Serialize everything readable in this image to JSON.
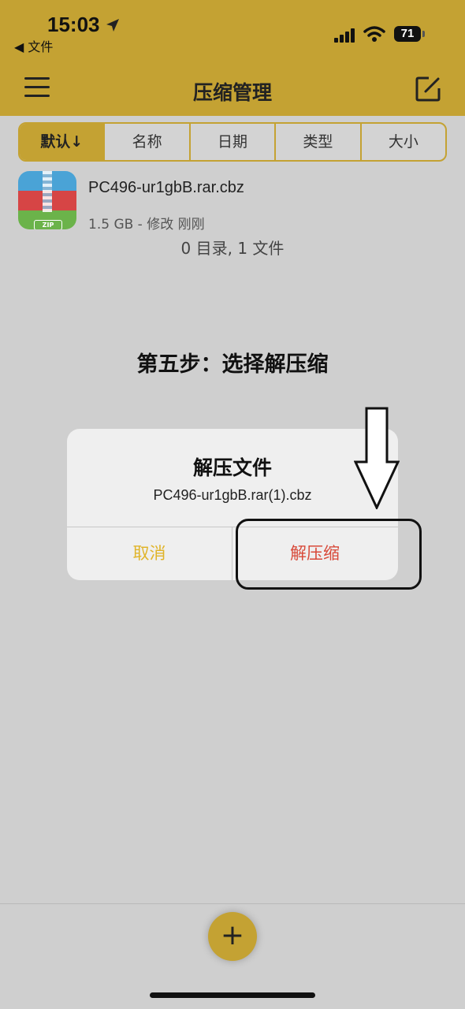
{
  "status_bar": {
    "time": "15:03",
    "back_app": "◀ 文件",
    "battery": "71"
  },
  "header": {
    "title": "压缩管理"
  },
  "sort_tabs": [
    {
      "label": "默认↓",
      "active": true
    },
    {
      "label": "名称",
      "active": false
    },
    {
      "label": "日期",
      "active": false
    },
    {
      "label": "类型",
      "active": false
    },
    {
      "label": "大小",
      "active": false
    }
  ],
  "file": {
    "name": "PC496-ur1gbB.rar.cbz",
    "meta": "1.5 GB - 修改 刚刚",
    "icon_label": "ZIP"
  },
  "summary": "0 目录, 1 文件",
  "step_caption": "第五步：选择解压缩",
  "dialog": {
    "title": "解压文件",
    "message": "PC496-ur1gbB.rar(1).cbz",
    "cancel_label": "取消",
    "confirm_label": "解压缩"
  },
  "fab": {
    "label": "+"
  },
  "colors": {
    "accent": "#c4a233",
    "cancel": "#e0b429",
    "confirm": "#d84a3a",
    "background": "#cfcfcf"
  }
}
